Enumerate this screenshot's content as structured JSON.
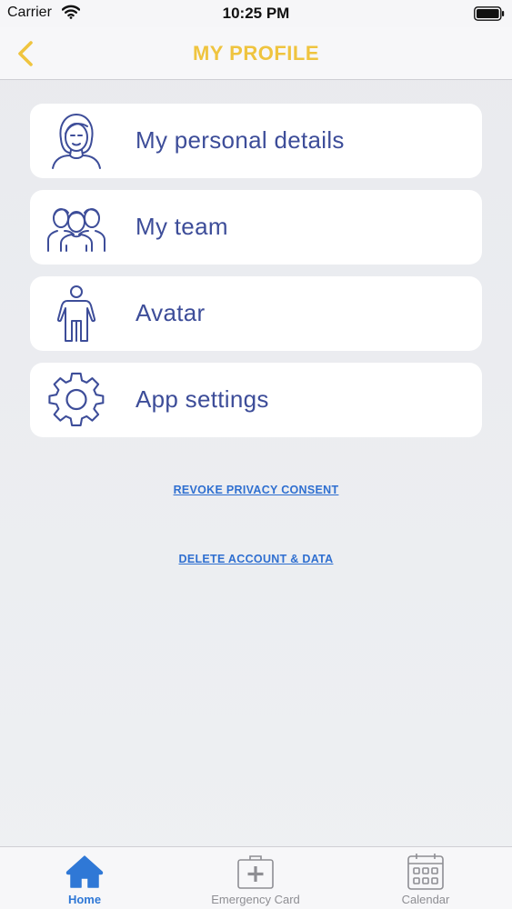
{
  "status_bar": {
    "carrier": "Carrier",
    "time": "10:25 PM"
  },
  "nav": {
    "title": "MY PROFILE",
    "back_icon": "chevron-left-icon"
  },
  "menu": {
    "items": [
      {
        "label": "My personal details",
        "icon": "person-face-icon"
      },
      {
        "label": "My team",
        "icon": "team-icon"
      },
      {
        "label": "Avatar",
        "icon": "body-figure-icon"
      },
      {
        "label": "App settings",
        "icon": "gear-icon"
      }
    ]
  },
  "links": {
    "revoke": "REVOKE PRIVACY CONSENT",
    "delete": "DELETE ACCOUNT & DATA"
  },
  "tabs": [
    {
      "label": "Home",
      "icon": "home-icon",
      "active": true
    },
    {
      "label": "Emergency Card",
      "icon": "medical-kit-icon",
      "active": false
    },
    {
      "label": "Calendar",
      "icon": "calendar-icon",
      "active": false
    }
  ],
  "colors": {
    "accent_yellow": "#efc43f",
    "menu_text": "#3d4d99",
    "link_blue": "#2f6fd0",
    "tab_active": "#2f78d6",
    "tab_inactive": "#8e8e93"
  }
}
